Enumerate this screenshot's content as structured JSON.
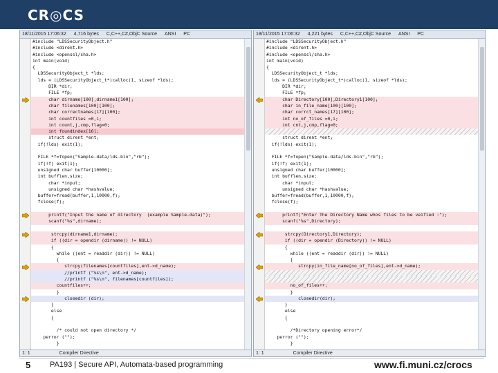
{
  "header": {
    "logo": "CR◎CS"
  },
  "left": {
    "info": {
      "date": "18/11/2015 17:06:32",
      "size": "4,716 bytes",
      "lang": "C,C++,C#,ObjC Source",
      "encoding": "ANSI",
      "platform": "PC"
    },
    "status": {
      "position": "1: 1",
      "mode": "Compiler Directive"
    },
    "lines": [
      {
        "t": "#include \"LDSSecurityObject.h\"",
        "c": ""
      },
      {
        "t": "#include <dirent.h>",
        "c": ""
      },
      {
        "t": "#include <openssl/sha.h>",
        "c": ""
      },
      {
        "t": "int main(void)",
        "c": ""
      },
      {
        "t": "{",
        "c": ""
      },
      {
        "t": "  LDSSecurityObject_t *lds;",
        "c": ""
      },
      {
        "t": "  lds = (LDSSecurityObject_t*)calloc(1, sizeof *lds);",
        "c": ""
      },
      {
        "t": "      DIR *dir;",
        "c": ""
      },
      {
        "t": "      FILE *fp;",
        "c": ""
      },
      {
        "t": "      char dirname[100],dirname1[100];",
        "c": "changed"
      },
      {
        "t": "      char filenames[100][100];",
        "c": "changed"
      },
      {
        "t": "      char correctnames[17][100];",
        "c": "changed"
      },
      {
        "t": "      int countfiles =0,i;",
        "c": "changed"
      },
      {
        "t": "      int count,j,cmp,flag=0;",
        "c": "changed"
      },
      {
        "t": "      int foundindex[16];",
        "c": "strong"
      },
      {
        "t": "      struct dirent *ent;",
        "c": ""
      },
      {
        "t": "  if(!lds) exit(1);",
        "c": ""
      },
      {
        "t": "",
        "c": ""
      },
      {
        "t": "  FILE *f=fopen(\"Sample-data/lds.bin\",\"rb\");",
        "c": ""
      },
      {
        "t": "  if(!f) exit(1);",
        "c": ""
      },
      {
        "t": "  unsigned char buffer[10000];",
        "c": ""
      },
      {
        "t": "  int bufflen,size;",
        "c": ""
      },
      {
        "t": "      char *input;",
        "c": ""
      },
      {
        "t": "      unsigned char *hashvalue;",
        "c": ""
      },
      {
        "t": "  buffer=fread(buffer,1,10000,f);",
        "c": ""
      },
      {
        "t": "  fclose(f);",
        "c": ""
      },
      {
        "t": "",
        "c": ""
      },
      {
        "t": "      printf(\"Input the name of directory  (example Sample-data)\");",
        "c": "changed"
      },
      {
        "t": "      scanf(\"%s\",dirname);",
        "c": "changed"
      },
      {
        "t": "",
        "c": ""
      },
      {
        "t": "       strcpy(dirname1,dirname);",
        "c": "changed"
      },
      {
        "t": "       if ((dir = opendir (dirname)) != NULL)",
        "c": "changed"
      },
      {
        "t": "       {",
        "c": ""
      },
      {
        "t": "         while ((ent = readdir (dir)) != NULL)",
        "c": ""
      },
      {
        "t": "         {",
        "c": ""
      },
      {
        "t": "            strcpy(filenames[countfiles],ent->d_name);",
        "c": "changed"
      },
      {
        "t": "            //printf (\"%s\\n\", ent->d_name);",
        "c": "moved"
      },
      {
        "t": "            //printf (\"%s\\n\", filenames[countfiles]);",
        "c": "moved"
      },
      {
        "t": "         countfiles++;",
        "c": "changed"
      },
      {
        "t": "         }",
        "c": ""
      },
      {
        "t": "            closedir (dir);",
        "c": "moved"
      },
      {
        "t": "       }",
        "c": ""
      },
      {
        "t": "       else",
        "c": ""
      },
      {
        "t": "       {",
        "c": ""
      },
      {
        "t": "",
        "c": ""
      },
      {
        "t": "         /* could not open directory */",
        "c": ""
      },
      {
        "t": "    perror (\"\");",
        "c": ""
      },
      {
        "t": "         }",
        "c": ""
      }
    ]
  },
  "right": {
    "info": {
      "date": "18/11/2015 17:06:32",
      "size": "4,221 bytes",
      "lang": "C,C++,C#,ObjC Source",
      "encoding": "ANSI",
      "platform": "PC"
    },
    "status": {
      "position": "1: 1",
      "mode": "Compiler Directive"
    },
    "lines": [
      {
        "t": "#include \"LDSSecurityObject.h\"",
        "c": ""
      },
      {
        "t": "#include <dirent.h>",
        "c": ""
      },
      {
        "t": "#include <openssl/sha.h>",
        "c": ""
      },
      {
        "t": "int main(void)",
        "c": ""
      },
      {
        "t": "{",
        "c": ""
      },
      {
        "t": "  LDSSecurityObject_t *lds;",
        "c": ""
      },
      {
        "t": "  lds = (LDSSecurityObject_t*)calloc(1, sizeof *lds);",
        "c": ""
      },
      {
        "t": "      DIR *dir;",
        "c": ""
      },
      {
        "t": "      FILE *fp;",
        "c": ""
      },
      {
        "t": "      char Directory[100],Directory1[100];",
        "c": "changed"
      },
      {
        "t": "      char in_file_name[100][100];",
        "c": "changed"
      },
      {
        "t": "      char corrct_names[17][100];",
        "c": "changed"
      },
      {
        "t": "      int no_of_files =0,i;",
        "c": "changed"
      },
      {
        "t": "      int cnt,j,cmp,flag=0;",
        "c": "changed"
      },
      {
        "t": "",
        "c": "filler"
      },
      {
        "t": "      struct dirent *ent;",
        "c": ""
      },
      {
        "t": "  if(!lds) exit(1);",
        "c": ""
      },
      {
        "t": "",
        "c": ""
      },
      {
        "t": "  FILE *f=fopen(\"Sample-data/lds.bin\",\"rb\");",
        "c": ""
      },
      {
        "t": "  if(!f) exit(1);",
        "c": ""
      },
      {
        "t": "  unsigned char buffer[10000];",
        "c": ""
      },
      {
        "t": "  int bufflen,size;",
        "c": ""
      },
      {
        "t": "      char *input;",
        "c": ""
      },
      {
        "t": "      unsigned char *hashvalue;",
        "c": ""
      },
      {
        "t": "  buffer=fread(buffer,1,10000,f);",
        "c": ""
      },
      {
        "t": "  fclose(f);",
        "c": ""
      },
      {
        "t": "",
        "c": ""
      },
      {
        "t": "      printf(\"Enter The Directory Name whos files to be veified :\");",
        "c": "changed"
      },
      {
        "t": "      scanf(\"%s\",Directory);",
        "c": "changed"
      },
      {
        "t": "",
        "c": ""
      },
      {
        "t": "       strcpy(Directory1,Directory);",
        "c": "changed"
      },
      {
        "t": "       if ((dir = opendir (Directory)) != NULL)",
        "c": "changed"
      },
      {
        "t": "       {",
        "c": ""
      },
      {
        "t": "         while ((ent = readdir (dir)) != NULL)",
        "c": ""
      },
      {
        "t": "         {",
        "c": ""
      },
      {
        "t": "            strcpy(in_file_name[no_of_files],ent->d_name);",
        "c": "changed"
      },
      {
        "t": "",
        "c": "filler"
      },
      {
        "t": "",
        "c": "filler"
      },
      {
        "t": "         no_of_files++;",
        "c": "changed"
      },
      {
        "t": "         }",
        "c": ""
      },
      {
        "t": "            closedir(dir);",
        "c": "moved"
      },
      {
        "t": "       }",
        "c": ""
      },
      {
        "t": "       else",
        "c": ""
      },
      {
        "t": "       {",
        "c": ""
      },
      {
        "t": "",
        "c": ""
      },
      {
        "t": "         /*Directory opening error*/",
        "c": ""
      },
      {
        "t": "    perror (\"\");",
        "c": ""
      },
      {
        "t": "         }",
        "c": ""
      }
    ]
  },
  "diff_colors": {
    "changed": "#fbe0e3",
    "strong": "#f9c8ce",
    "moved": "#e3e6f8",
    "arrow": "#e0a100"
  },
  "footer": {
    "page": "5",
    "title": "PA193 | Secure API, Automata-based programming",
    "url": "www.fi.muni.cz/crocs"
  }
}
